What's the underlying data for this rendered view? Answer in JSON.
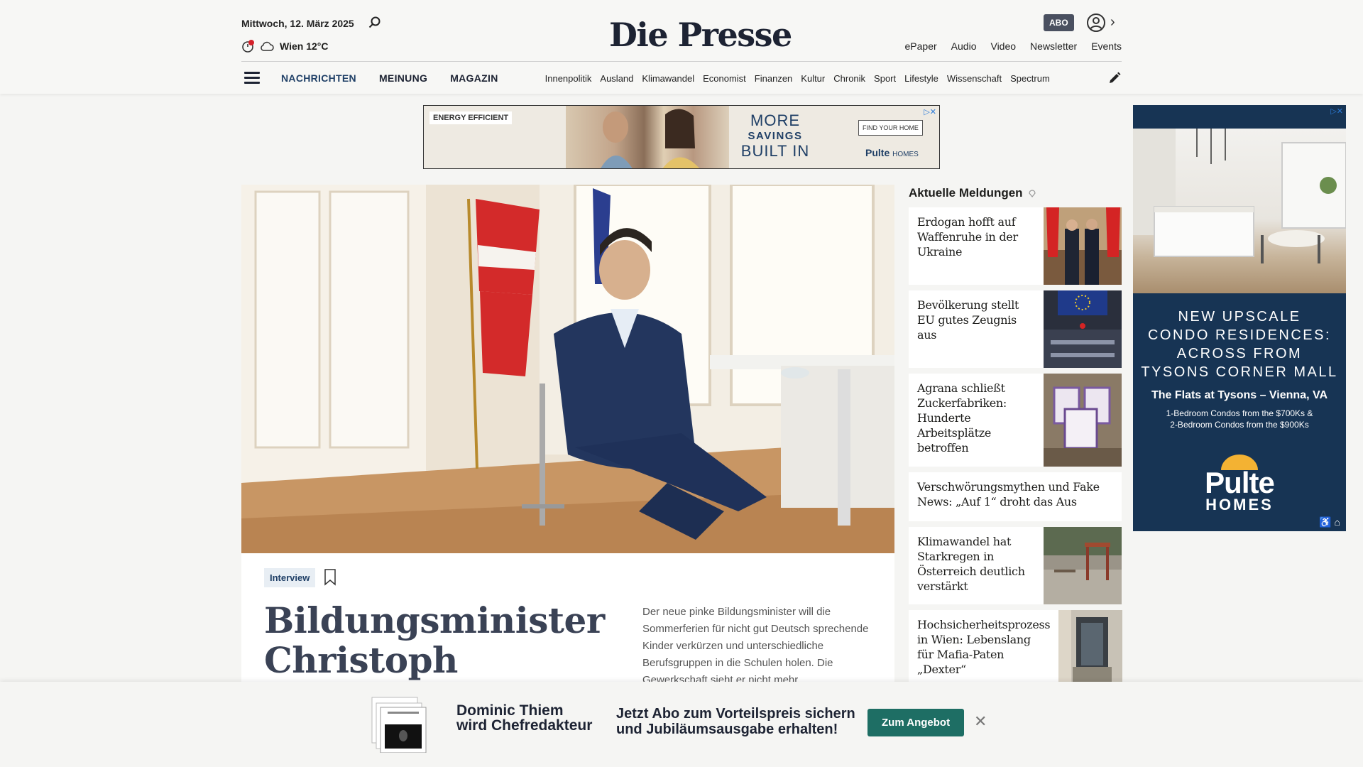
{
  "header": {
    "date": "Mittwoch, 12. März 2025",
    "weather": "Wien 12°C",
    "logo": "Die Presse",
    "abo_badge": "ABO",
    "links": [
      "ePaper",
      "Audio",
      "Video",
      "Newsletter",
      "Events"
    ]
  },
  "nav": {
    "main": [
      "NACHRICHTEN",
      "MEINUNG",
      "MAGAZIN"
    ],
    "sub": [
      "Innenpolitik",
      "Ausland",
      "Klimawandel",
      "Economist",
      "Finanzen",
      "Kultur",
      "Chronik",
      "Sport",
      "Lifestyle",
      "Wissenschaft",
      "Spectrum"
    ]
  },
  "banner_ad": {
    "tag": "ENERGY EFFICIENT",
    "line1": "MORE",
    "line2": "SAVINGS",
    "line3": "BUILT IN",
    "cta": "FIND YOUR HOME",
    "brand": "Pulte",
    "brand_suffix": "HOMES"
  },
  "hero": {
    "tag": "Interview",
    "title": "Bildungsminister Christoph",
    "lead": "Der neue pinke Bildungsminister will die Sommerferien für nicht gut Deutsch sprechende Kinder verkürzen und unterschiedliche Berufsgruppen in die Schulen holen. Die Gewerkschaft sieht er nicht mehr"
  },
  "sidebar": {
    "heading": "Aktuelle Meldungen",
    "items": [
      {
        "title": "Erdogan hofft auf Waffenruhe in der Ukraine",
        "thumb": "flags-handshake"
      },
      {
        "title": "Bevölkerung stellt EU gutes Zeugnis aus",
        "thumb": "eu-parliament"
      },
      {
        "title": "Agrana schließt Zuckerfabriken: Hunderte Arbeitsplätze betroffen",
        "thumb": "sugar-packages"
      },
      {
        "title": "Verschwörungsmythen und Fake News: „Auf 1“ droht das Aus",
        "thumb": ""
      },
      {
        "title": "Klimawandel hat Starkregen in Österreich deutlich verstärkt",
        "thumb": "flooded-playground"
      },
      {
        "title": "Hochsicherheitsprozess in Wien: Lebenslang für Mafia-Paten „Dexter“",
        "thumb": "court-building"
      }
    ]
  },
  "sky_ad": {
    "heading_lines": [
      "NEW UPSCALE",
      "CONDO RESIDENCES:",
      "ACROSS FROM",
      "TYSONS CORNER MALL"
    ],
    "subheading": "The Flats at Tysons – Vienna, VA",
    "details_lines": [
      "1-Bedroom Condos from the $700Ks &",
      "2-Bedroom Condos from the $900Ks"
    ],
    "brand": "Pulte",
    "brand_suffix": "HOMES"
  },
  "promo": {
    "name_line1": "Dominic Thiem",
    "name_line2": "wird Chefredakteur",
    "text_line1": "Jetzt Abo zum Vorteilspreis sichern",
    "text_line2": "und Jubiläumsausgabe erhalten!",
    "button": "Zum Angebot"
  },
  "colors": {
    "navy": "#1d2333",
    "accent_blue": "#1f3f66",
    "promo_button": "#1e6e64",
    "ad_navy": "#173454"
  }
}
